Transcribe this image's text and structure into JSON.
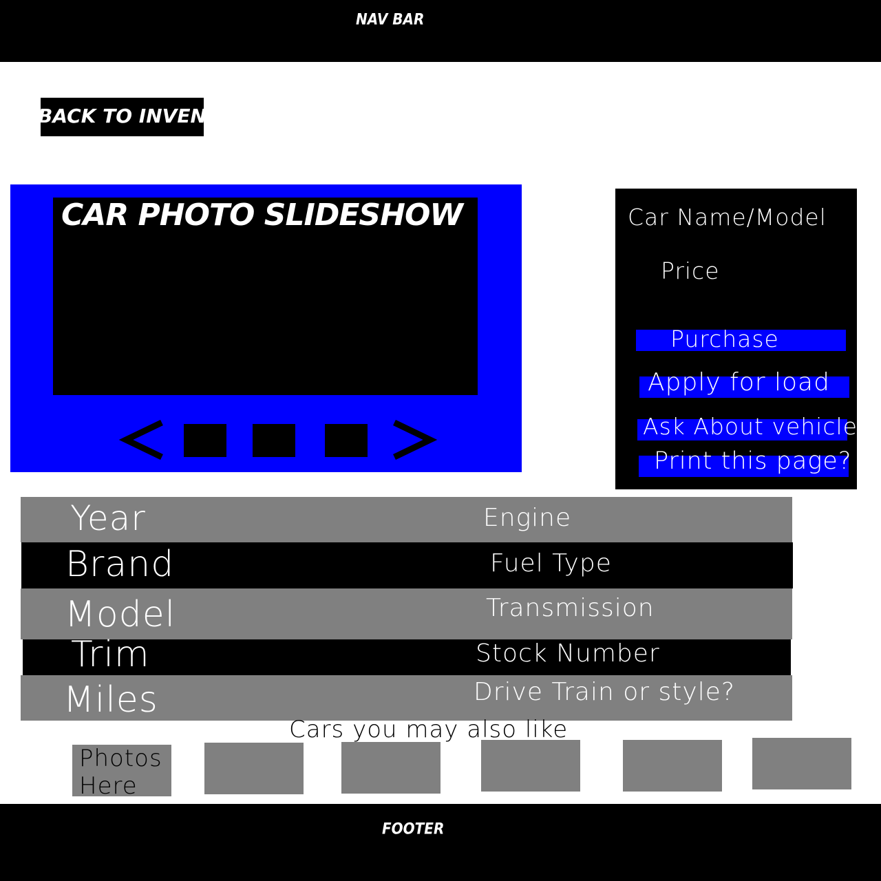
{
  "navbar": {
    "label": "NAV BAR"
  },
  "back_button": {
    "label": "BACK TO INVENTORY"
  },
  "slideshow": {
    "title": "CAR PHOTO SLIDESHOW",
    "prev_icon": "chevron-left-icon",
    "next_icon": "chevron-right-icon",
    "thumbnail_count": 3
  },
  "info_panel": {
    "car_name": "Car Name/Model",
    "price": "Price",
    "buttons": {
      "purchase": "Purchase",
      "apply": "Apply for load",
      "ask": "Ask About vehicle",
      "print": "Print this page?"
    }
  },
  "specs": {
    "rows": [
      {
        "left": "Year",
        "right": "Engine"
      },
      {
        "left": "Brand",
        "right": "Fuel Type"
      },
      {
        "left": "Model",
        "right": "Transmission"
      },
      {
        "left": "Trim",
        "right": "Stock Number"
      },
      {
        "left": "Miles",
        "right": "Drive Train or style?"
      }
    ]
  },
  "similar": {
    "title": "Cars you may also like",
    "first_card_label": "Photos Here"
  },
  "footer": {
    "label": "FOOTER"
  },
  "colors": {
    "accent_blue": "#0000ff",
    "panel_black": "#000000",
    "row_gray": "#808080"
  }
}
